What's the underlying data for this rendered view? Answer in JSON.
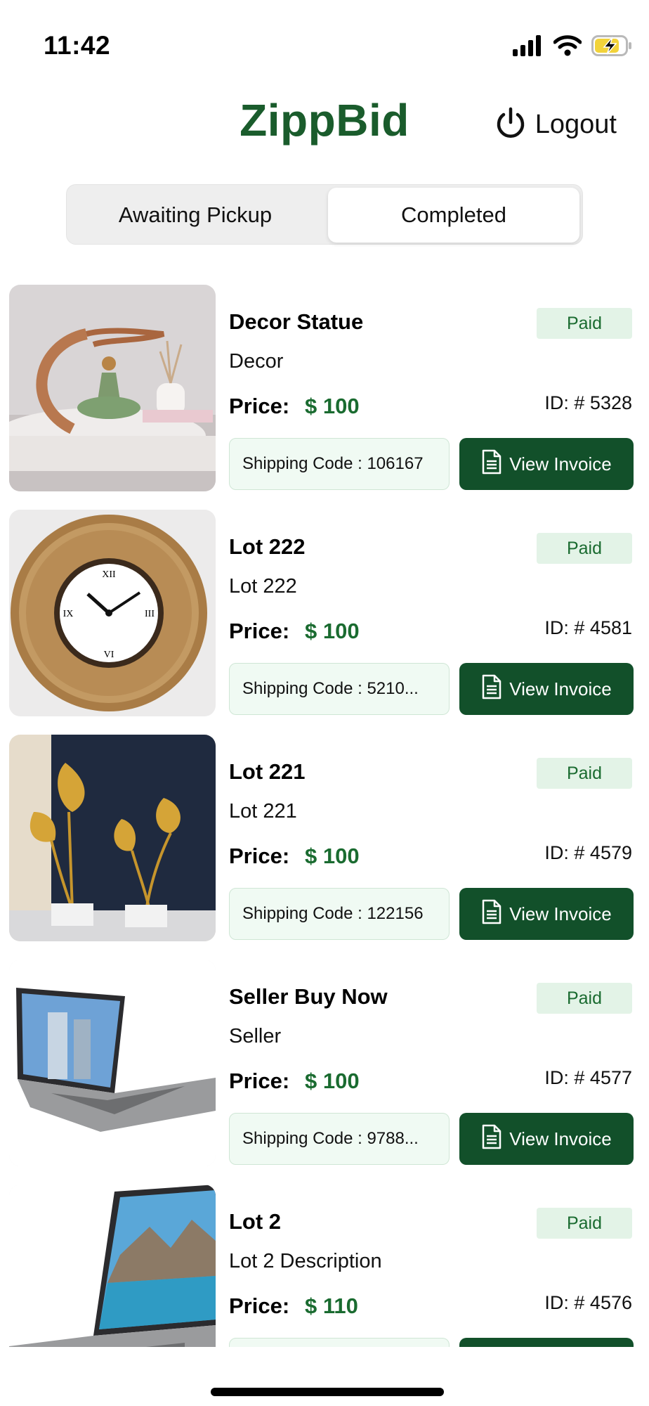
{
  "status_bar": {
    "time": "11:42",
    "icons": [
      "signal-icon",
      "wifi-icon",
      "battery-charging-icon"
    ]
  },
  "header": {
    "brand": "ZippBid",
    "logout_label": "Logout",
    "brand_color": "#1a5c2c"
  },
  "tabs": [
    {
      "label": "Awaiting Pickup",
      "selected": false
    },
    {
      "label": "Completed",
      "selected": true
    }
  ],
  "price_label": "Price:",
  "invoice_label": "View Invoice",
  "orders": [
    {
      "title": "Decor Statue",
      "subtitle": "Decor",
      "status": "Paid",
      "price": "$ 100",
      "id": "ID: # 5328",
      "shipping": "Shipping Code : 106167",
      "image": "decor-statue-image"
    },
    {
      "title": "Lot 222",
      "subtitle": "Lot 222",
      "status": "Paid",
      "price": "$ 100",
      "id": "ID: # 4581",
      "shipping": "Shipping Code : 5210...",
      "image": "wall-clock-image"
    },
    {
      "title": "Lot 221",
      "subtitle": "Lot 221",
      "status": "Paid",
      "price": "$ 100",
      "id": "ID: # 4579",
      "shipping": "Shipping Code : 122156",
      "image": "gold-leaf-sculpture-image"
    },
    {
      "title": "Seller Buy Now",
      "subtitle": "Seller",
      "status": "Paid",
      "price": "$ 100",
      "id": "ID: # 4577",
      "shipping": "Shipping Code : 9788...",
      "image": "laptop-image"
    },
    {
      "title": "Lot 2",
      "subtitle": "Lot 2 Description",
      "status": "Paid",
      "price": "$ 110",
      "id": "ID: # 4576",
      "shipping": "",
      "image": "laptop-lake-image"
    }
  ],
  "colors": {
    "accent": "#12502a",
    "price": "#1a6b30",
    "paid_badge_bg": "#e3f3e7",
    "shipping_bg": "#f0faf3"
  }
}
